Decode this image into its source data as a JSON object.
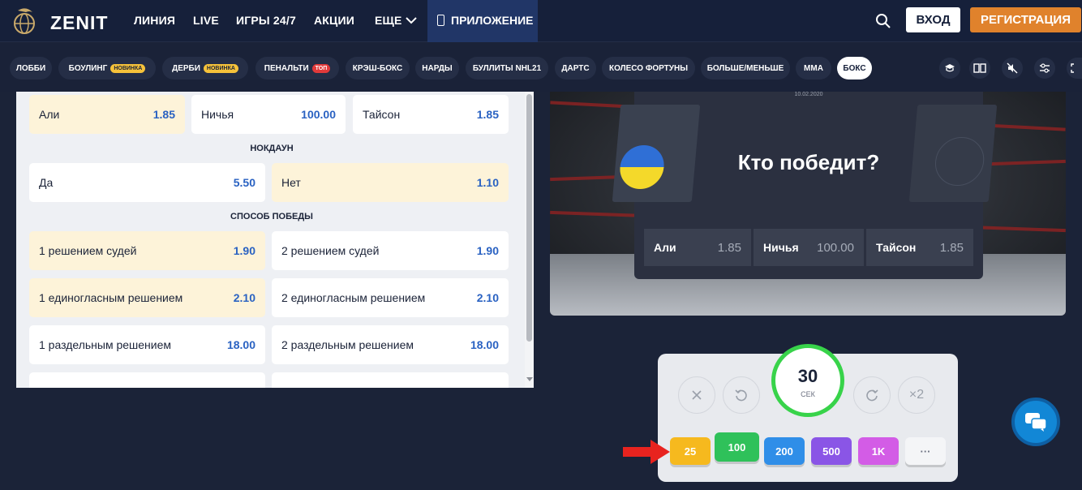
{
  "header": {
    "logo_text": "ZENIT",
    "nav": [
      "ЛИНИЯ",
      "LIVE",
      "ИГРЫ 24/7",
      "АКЦИИ",
      "ЕЩЕ"
    ],
    "app_tab": "ПРИЛОЖЕНИЕ",
    "login": "ВХОД",
    "register": "РЕГИСТРАЦИЯ"
  },
  "games": {
    "items": [
      {
        "label": "ЛОББИ",
        "badge": ""
      },
      {
        "label": "БОУЛИНГ",
        "badge": "НОВИНКА"
      },
      {
        "label": "ДЕРБИ",
        "badge": "НОВИНКА"
      },
      {
        "label": "ПЕНАЛЬТИ",
        "badge": "ТОП"
      },
      {
        "label": "КРЭШ-БОКС",
        "badge": ""
      },
      {
        "label": "НАРДЫ",
        "badge": ""
      },
      {
        "label": "БУЛЛИТЫ NHL21",
        "badge": ""
      },
      {
        "label": "ДАРТС",
        "badge": ""
      },
      {
        "label": "КОЛЕСО ФОРТУНЫ",
        "badge": ""
      },
      {
        "label": "БОЛЬШЕ/МЕНЬШЕ",
        "badge": ""
      },
      {
        "label": "ММА",
        "badge": ""
      },
      {
        "label": "БОКС",
        "badge": ""
      }
    ],
    "icons": [
      "graduation-cap-icon",
      "book-icon",
      "sound-off-icon",
      "settings-icon",
      "expand-icon"
    ]
  },
  "markets": {
    "winner": [
      {
        "label": "Али",
        "odds": "1.85",
        "selected": true
      },
      {
        "label": "Ничья",
        "odds": "100.00",
        "selected": false
      },
      {
        "label": "Тайсон",
        "odds": "1.85",
        "selected": false
      }
    ],
    "knockdown_title": "НОКДАУН",
    "knockdown": [
      {
        "label": "Да",
        "odds": "5.50",
        "selected": false
      },
      {
        "label": "Нет",
        "odds": "1.10",
        "selected": true
      }
    ],
    "method_title": "СПОСОБ ПОБЕДЫ",
    "method": [
      {
        "label": "1 решением судей",
        "odds": "1.90",
        "selected": true
      },
      {
        "label": "2 решением судей",
        "odds": "1.90",
        "selected": false
      },
      {
        "label": "1 единогласным решением",
        "odds": "2.10",
        "selected": true
      },
      {
        "label": "2 единогласным решением",
        "odds": "2.10",
        "selected": false
      },
      {
        "label": "1 раздельным решением",
        "odds": "18.00",
        "selected": false
      },
      {
        "label": "2 раздельным решением",
        "odds": "18.00",
        "selected": false
      }
    ]
  },
  "game": {
    "date": "10.02.2020",
    "question": "Кто победит?",
    "odds": [
      {
        "label": "Али",
        "value": "1.85"
      },
      {
        "label": "Ничья",
        "value": "100.00"
      },
      {
        "label": "Тайсон",
        "value": "1.85"
      }
    ]
  },
  "bet": {
    "timer_value": "30",
    "timer_unit": "СЕК",
    "double": "×2",
    "more": "···",
    "chips": [
      {
        "label": "25",
        "color": "#f6b91e"
      },
      {
        "label": "100",
        "color": "#2fc15a"
      },
      {
        "label": "200",
        "color": "#2f8ee8"
      },
      {
        "label": "500",
        "color": "#8a55e6"
      },
      {
        "label": "1K",
        "color": "#d35ce6"
      }
    ]
  },
  "colors": {
    "background": "#1b2338",
    "accent_orange": "#e0822c",
    "odds_blue": "#2a62c2",
    "timer_green": "#38d34a"
  }
}
